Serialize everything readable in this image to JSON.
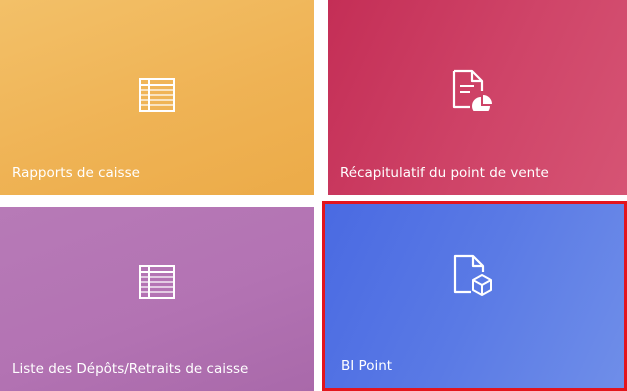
{
  "tiles": {
    "rapports": {
      "label": "Rapports de caisse",
      "icon": "table-icon",
      "color": "#efb355"
    },
    "recap": {
      "label": "Récapitulatif du point de vente",
      "icon": "document-chart-icon",
      "color": "#cf4468"
    },
    "liste": {
      "label": "Liste des Dépôts/Retraits de caisse",
      "icon": "table-icon",
      "color": "#b373b3"
    },
    "bi": {
      "label": "BI Point",
      "icon": "document-cube-icon",
      "color": "#5a7ae5",
      "selected": true,
      "selection_border": "#e3151d"
    }
  }
}
